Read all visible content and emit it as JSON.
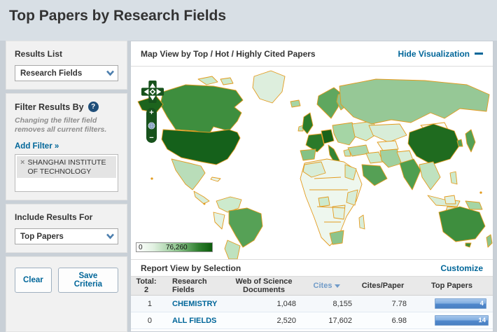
{
  "page_title": "Top Papers by Research Fields",
  "sidebar": {
    "results_list_label": "Results List",
    "results_list_value": "Research Fields",
    "filter_heading": "Filter Results By",
    "help_icon": "?",
    "filter_note": "Changing the filter field removes all current filters.",
    "add_filter_label": "Add Filter »",
    "filter_tag": {
      "remove_icon": "×",
      "label": "SHANGHAI INSTITUTE OF TECHNOLOGY"
    },
    "include_label": "Include Results For",
    "include_value": "Top Papers",
    "clear_button": "Clear",
    "save_button": "Save Criteria"
  },
  "viz": {
    "title": "Map View by Top / Hot / Highly Cited Papers",
    "hide_link": "Hide Visualization",
    "legend_min": "0",
    "legend_max": "76,260",
    "zoom_in": "+",
    "zoom_out": "−"
  },
  "report": {
    "title": "Report View by Selection",
    "customize_link": "Customize",
    "total_label": "Total:",
    "total_value": "2",
    "columns": {
      "fields": "Research Fields",
      "documents": "Web of Science Documents",
      "cites": "Cites",
      "cites_per_paper": "Cites/Paper",
      "top_papers": "Top Papers"
    },
    "rows": [
      {
        "num": "1",
        "field": "CHEMISTRY",
        "documents": "1,048",
        "cites": "8,155",
        "cites_per_paper": "7.78",
        "top_papers": "4",
        "bar_pct": 96
      },
      {
        "num": "0",
        "field": "ALL FIELDS",
        "documents": "2,520",
        "cites": "17,602",
        "cites_per_paper": "6.98",
        "top_papers": "14",
        "bar_pct": 100
      }
    ]
  },
  "chart_data": {
    "type": "table",
    "title": "Report View by Selection",
    "columns": [
      "Research Fields",
      "Web of Science Documents",
      "Cites",
      "Cites/Paper",
      "Top Papers"
    ],
    "rows": [
      [
        "CHEMISTRY",
        1048,
        8155,
        7.78,
        4
      ],
      [
        "ALL FIELDS",
        2520,
        17602,
        6.98,
        14
      ]
    ],
    "sorted_by": "Cites",
    "map_legend": {
      "min": 0,
      "max": 76260,
      "scale": "white-to-dark-green choropleth"
    }
  },
  "colors": {
    "link_blue": "#006699",
    "sort_blue": "#6f9ac8",
    "map_border_orange": "#e39b1e",
    "map_dark_green": "#15611b",
    "bar_blue": "#5088cc",
    "band_gray_blue": "#d8dfe5"
  }
}
